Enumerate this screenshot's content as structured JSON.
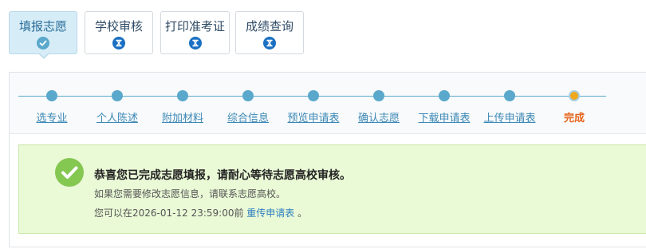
{
  "tabs": [
    {
      "label": "填报志愿",
      "icon": "check-icon",
      "state": "active"
    },
    {
      "label": "学校审核",
      "icon": "hourglass-icon",
      "state": "pending"
    },
    {
      "label": "打印准考证",
      "icon": "hourglass-icon",
      "state": "pending"
    },
    {
      "label": "成绩查询",
      "icon": "hourglass-icon",
      "state": "pending"
    }
  ],
  "steps": [
    {
      "label": "选专业"
    },
    {
      "label": "个人陈述"
    },
    {
      "label": "附加材料"
    },
    {
      "label": "综合信息"
    },
    {
      "label": "预览申请表"
    },
    {
      "label": "确认志愿"
    },
    {
      "label": "下载申请表"
    },
    {
      "label": "上传申请表"
    },
    {
      "label": "完成"
    }
  ],
  "current_step": 8,
  "success": {
    "title": "恭喜您已完成志愿填报，请耐心等待志愿高校审核。",
    "line1": "如果您需要修改志愿信息，请联系志愿高校。",
    "line2_prefix": "您可以在",
    "deadline": "2026-01-12 23:59:00",
    "line2_mid": "前 ",
    "reupload_link": "重传申请表",
    "line2_suffix": " 。"
  },
  "colors": {
    "accent": "#5aa8cb",
    "current": "#f0a81c",
    "success_bg": "#eaf9d6",
    "success_icon": "#84c751",
    "tab_active_bg": "#d6edf7",
    "pending_icon": "#1a70c2"
  }
}
